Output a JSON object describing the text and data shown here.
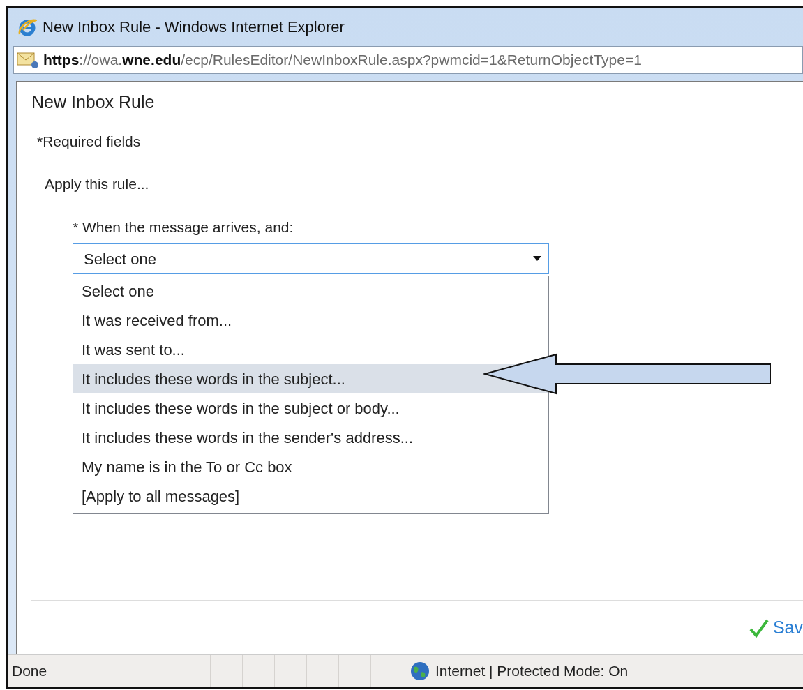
{
  "window": {
    "title": "New Inbox Rule - Windows Internet Explorer"
  },
  "address_bar": {
    "url": "**https**://owa.**wne.edu**/ecp/RulesEditor/NewInboxRule.aspx?pwmcid=1&ReturnObjectType=1"
  },
  "dialog": {
    "title": "New Inbox Rule",
    "required_note": "*Required fields",
    "section": "Apply this rule...",
    "field_label": "* When the message arrives, and:",
    "select": {
      "value": "Select one",
      "expanded": true,
      "options": [
        {
          "label": "Select one",
          "highlighted": false
        },
        {
          "label": "It was received from...",
          "highlighted": false
        },
        {
          "label": "It was sent to...",
          "highlighted": false
        },
        {
          "label": "It includes these words in the subject...",
          "highlighted": true
        },
        {
          "label": "It includes these words in the subject or body...",
          "highlighted": false
        },
        {
          "label": "It includes these words in the sender's address...",
          "highlighted": false
        },
        {
          "label": "My name is in the To or Cc box",
          "highlighted": false
        },
        {
          "label": "[Apply to all messages]",
          "highlighted": false
        }
      ]
    },
    "save_button": "Sav"
  },
  "status_bar": {
    "text": "Done",
    "zone": "Internet | Protected Mode: On"
  }
}
